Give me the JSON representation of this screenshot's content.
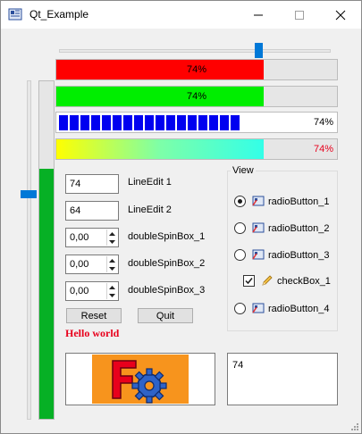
{
  "window": {
    "title": "Qt_Example",
    "controls": [
      "minimize-icon",
      "maximize-icon",
      "close-icon"
    ]
  },
  "slider": {
    "horizontal_value_fraction": 0.74,
    "vertical_value_fraction": 0.74
  },
  "progress": {
    "red_bar": {
      "value": 74,
      "text": "74%",
      "color": "#ff0000"
    },
    "green_bar": {
      "value": 74,
      "text": "74%",
      "color": "#00ee00"
    },
    "block_bar": {
      "value": 74,
      "text": "74%",
      "color": "#0000f0"
    },
    "gradient_bar": {
      "value": 74,
      "text": "74%",
      "colors": [
        "#ffff00",
        "#7dffa8",
        "#33ffe8"
      ],
      "text_color": "#e8001c"
    },
    "vertical_bar": {
      "value": 74,
      "color": "#06b025"
    }
  },
  "form": {
    "line_edit_1": {
      "value": "74",
      "label": "LineEdit 1"
    },
    "line_edit_2": {
      "value": "64",
      "label": "LineEdit 2"
    },
    "spin_1": {
      "value": "0,00",
      "label": "doubleSpinBox_1"
    },
    "spin_2": {
      "value": "0,00",
      "label": "doubleSpinBox_2"
    },
    "spin_3": {
      "value": "0,00",
      "label": "doubleSpinBox_3"
    }
  },
  "buttons": {
    "reset": "Reset",
    "quit": "Quit"
  },
  "hello_text": "Hello world",
  "view_group": {
    "title": "View",
    "radio_1": {
      "label": "radioButton_1",
      "checked": true
    },
    "radio_2": {
      "label": "radioButton_2",
      "checked": false
    },
    "radio_3": {
      "label": "radioButton_3",
      "checked": false
    },
    "checkbox_1": {
      "label": "checkBox_1",
      "checked": true
    },
    "radio_4": {
      "label": "radioButton_4",
      "checked": false
    }
  },
  "text_panel": {
    "value": "74"
  },
  "colors": {
    "accent": "#0078d7",
    "window_bg": "#f0f0f0",
    "hello_color": "#e8001c"
  }
}
